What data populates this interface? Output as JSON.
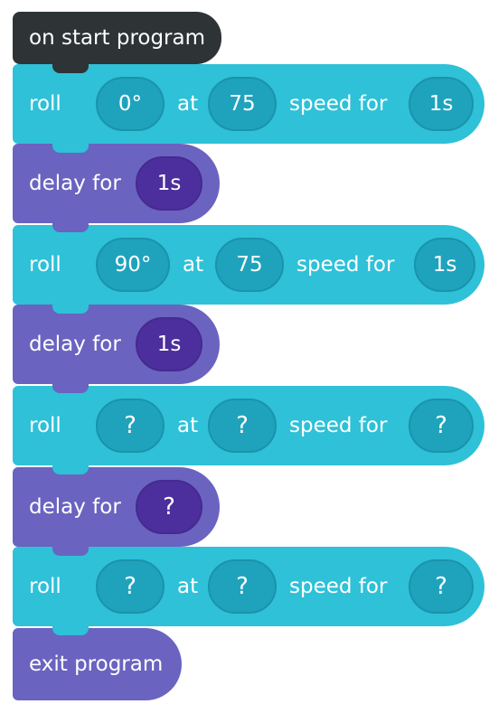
{
  "start": {
    "label": "on start program"
  },
  "roll_label": "roll",
  "at_label": "at",
  "speed_label": "speed for",
  "delay_label": "delay for",
  "rolls": [
    {
      "heading": "0°",
      "speed": "75",
      "duration": "1s"
    },
    {
      "heading": "90°",
      "speed": "75",
      "duration": "1s"
    },
    {
      "heading": "?",
      "speed": "?",
      "duration": "?"
    },
    {
      "heading": "?",
      "speed": "?",
      "duration": "?"
    }
  ],
  "delays": [
    {
      "duration": "1s"
    },
    {
      "duration": "1s"
    },
    {
      "duration": "?"
    }
  ],
  "exit": {
    "label": "exit program"
  },
  "colors": {
    "start_block": "#2e3336",
    "roll_block": "#2ec1d8",
    "roll_pill": "#1fa3bd",
    "delay_block": "#6a63c0",
    "delay_pill": "#4c2f9c"
  }
}
